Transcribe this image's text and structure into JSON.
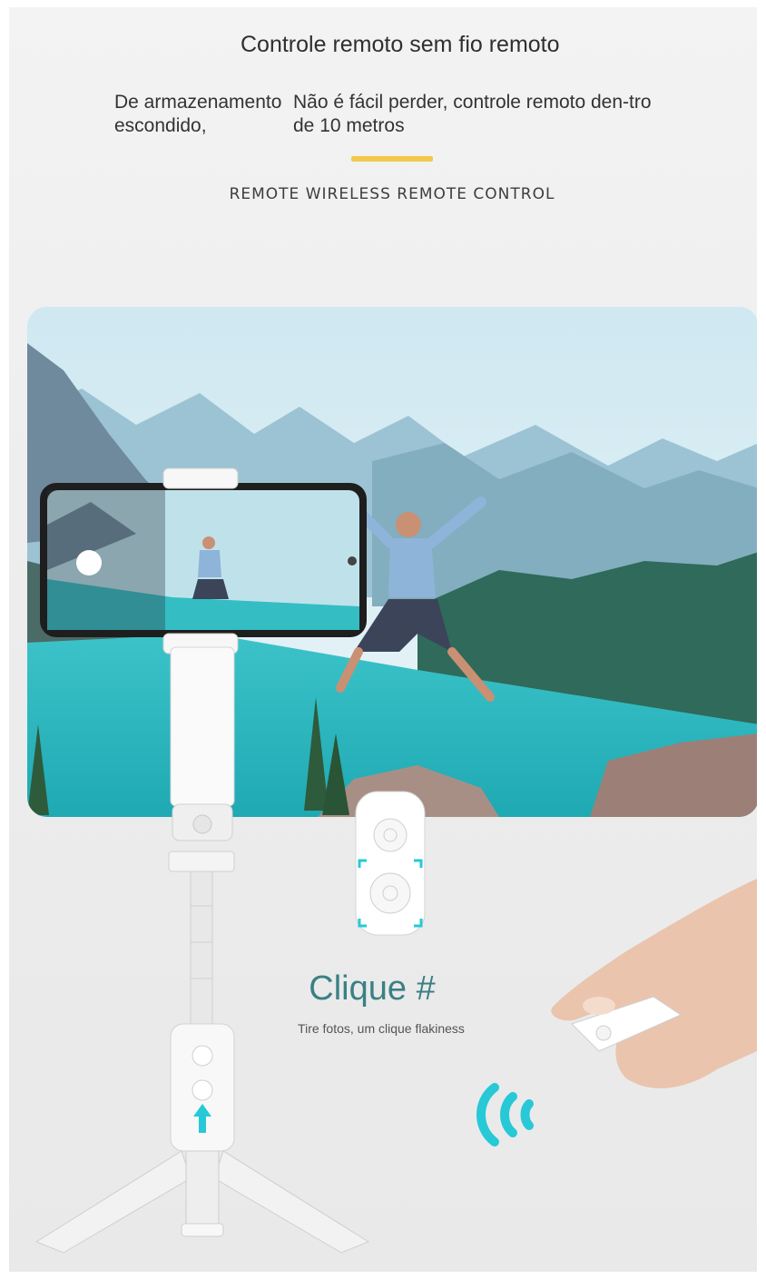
{
  "header": {
    "title": "Controle remoto sem fio remoto",
    "desc_left": "De armazenamento escondido,",
    "desc_right": "Não é fácil perder, controle remoto den-tro de 10 metros",
    "subtitle": "REMOTE WIRELESS REMOTE CONTROL"
  },
  "feature": {
    "caption": "Clique #",
    "caption_sub": "Tire fotos, um clique flakiness"
  },
  "colors": {
    "accent_bar": "#f2c94c",
    "caption": "#3b8084",
    "signal": "#27c9d6"
  },
  "icons": [
    "gimbal-stick-icon",
    "smartphone-icon",
    "remote-control-icon",
    "hand-icon",
    "wireless-signal-icon",
    "arrow-up-icon",
    "shutter-button-icon"
  ]
}
